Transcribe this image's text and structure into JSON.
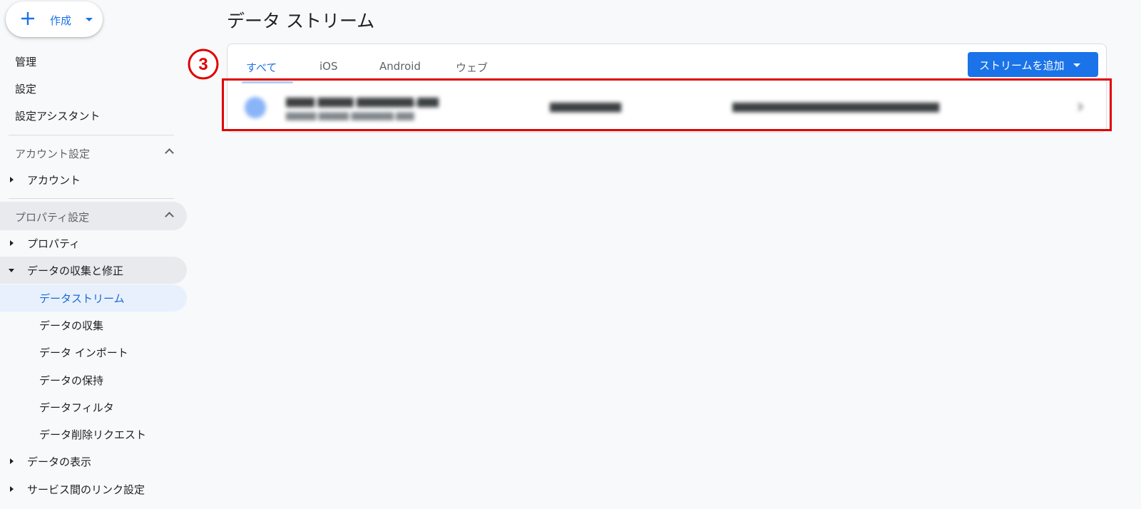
{
  "sidebar": {
    "create_label": "作成",
    "top_items": [
      "管理",
      "設定",
      "設定アシスタント"
    ],
    "account_section": {
      "heading": "アカウント設定",
      "items": [
        "アカウント"
      ]
    },
    "property_section": {
      "heading": "プロパティ設定",
      "property": "プロパティ",
      "data_collection": {
        "label": "データの収集と修正",
        "children": [
          "データストリーム",
          "データの収集",
          "データ インポート",
          "データの保持",
          "データフィルタ",
          "データ削除リクエスト"
        ]
      },
      "data_display": "データの表示",
      "links": "サービス間のリンク設定"
    }
  },
  "main": {
    "title": "データ ストリーム",
    "step_marker": "3",
    "tabs": [
      {
        "label": "すべて",
        "active": true
      },
      {
        "label": "iOS",
        "active": false
      },
      {
        "label": "Android",
        "active": false
      },
      {
        "label": "ウェブ",
        "active": false
      }
    ],
    "add_stream_label": "ストリームを追加"
  },
  "colors": {
    "accent": "#1a73e8",
    "highlight_box": "#e00000"
  }
}
